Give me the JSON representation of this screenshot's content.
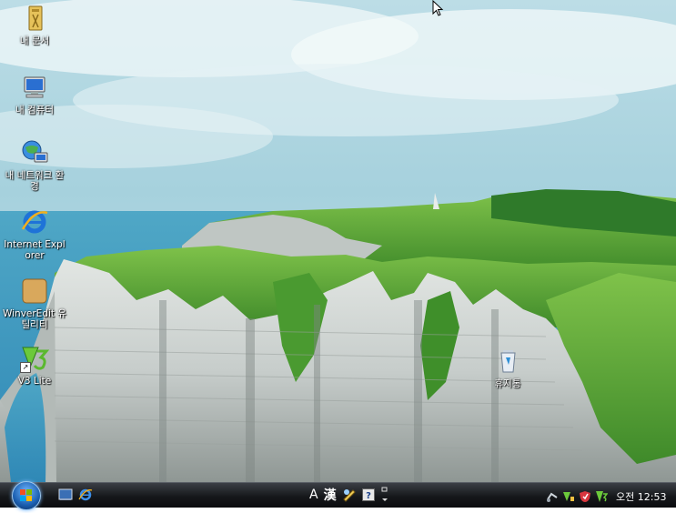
{
  "desktop_icons": [
    {
      "name": "my-documents-icon",
      "label": "내 문서"
    },
    {
      "name": "my-computer-icon",
      "label": "내 컴퓨터"
    },
    {
      "name": "network-icon",
      "label": "내 네트워크 환경"
    },
    {
      "name": "internet-explorer-icon",
      "label": "Internet Explorer"
    },
    {
      "name": "winveredit-icon",
      "label": "WinverEdit 유틸리티"
    },
    {
      "name": "v3-lite-icon",
      "label": "V3 Lite"
    },
    {
      "name": "recycle-bin-icon",
      "label": "휴지통"
    }
  ],
  "taskbar": {
    "start_icon": "windows-orb-icon",
    "quicklaunch": [
      "show-desktop-icon",
      "internet-explorer-icon"
    ],
    "language_bar": {
      "input_mode": "A",
      "hanja": "漢"
    },
    "clock": {
      "ampm": "오전",
      "time": "12:53"
    }
  }
}
